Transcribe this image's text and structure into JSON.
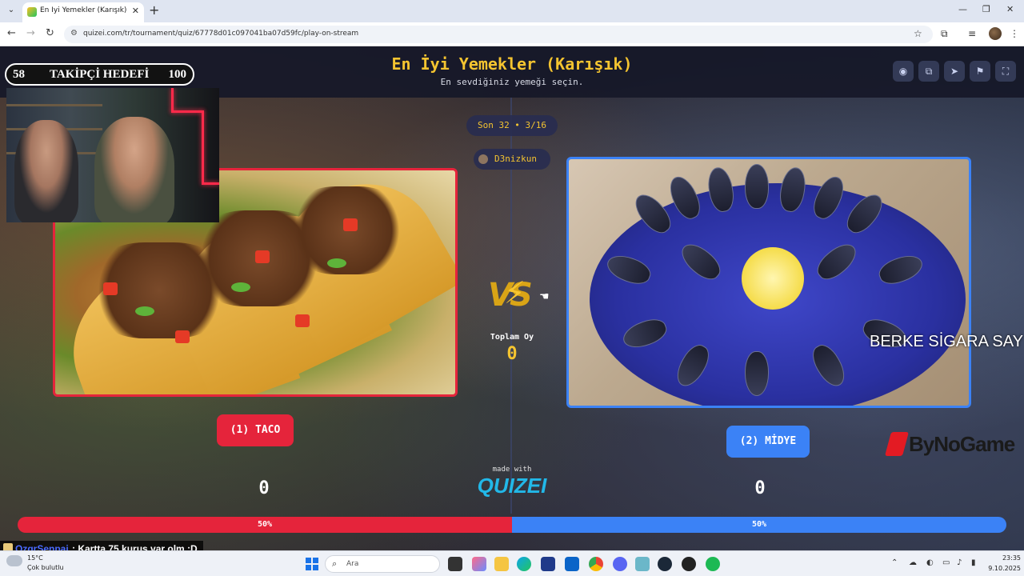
{
  "browser": {
    "tab_title": "En İyi Yemekler (Karışık) - Quizei",
    "url": "quizei.com/tr/tournament/quiz/67778d01c097041ba07d59fc/play-on-stream"
  },
  "quiz": {
    "title": "En İyi Yemekler (Karışık)",
    "subtitle": "En sevdiğiniz yemeği seçin.",
    "round": "Son 32 • 3/16",
    "user": "D3nizkun",
    "vs": "VS",
    "total_label": "Toplam Oy",
    "total_value": "0",
    "left_option": {
      "label": "(1) TACO",
      "score": "0",
      "percent_label": "50%",
      "percent": 50
    },
    "right_option": {
      "label": "(2) MİDYE",
      "score": "0",
      "percent_label": "50%",
      "percent": 50
    },
    "made_with": "made with",
    "brand": "QUIZEI"
  },
  "stream_overlay": {
    "follow_current": "58",
    "follow_label": "TAKİPÇİ HEDEFİ",
    "follow_max": "100",
    "follow_progress": 0.0,
    "overlay_text": "BERKE SİGARA SAY",
    "sponsor": "ByNoGame",
    "chat_user": "OzgrSenpai",
    "chat_message": ": Kartta 75 kuruş var olm :D"
  },
  "taskbar": {
    "weather_temp": "15°C",
    "weather_desc": "Çok bulutlu",
    "search_placeholder": "Ara",
    "time": "23:35",
    "date": "9.10.2025"
  },
  "colors": {
    "accent_yellow": "#f4c430",
    "left_red": "#e5243b",
    "right_blue": "#3b82f6",
    "goal_green": "#3cc8a0"
  }
}
